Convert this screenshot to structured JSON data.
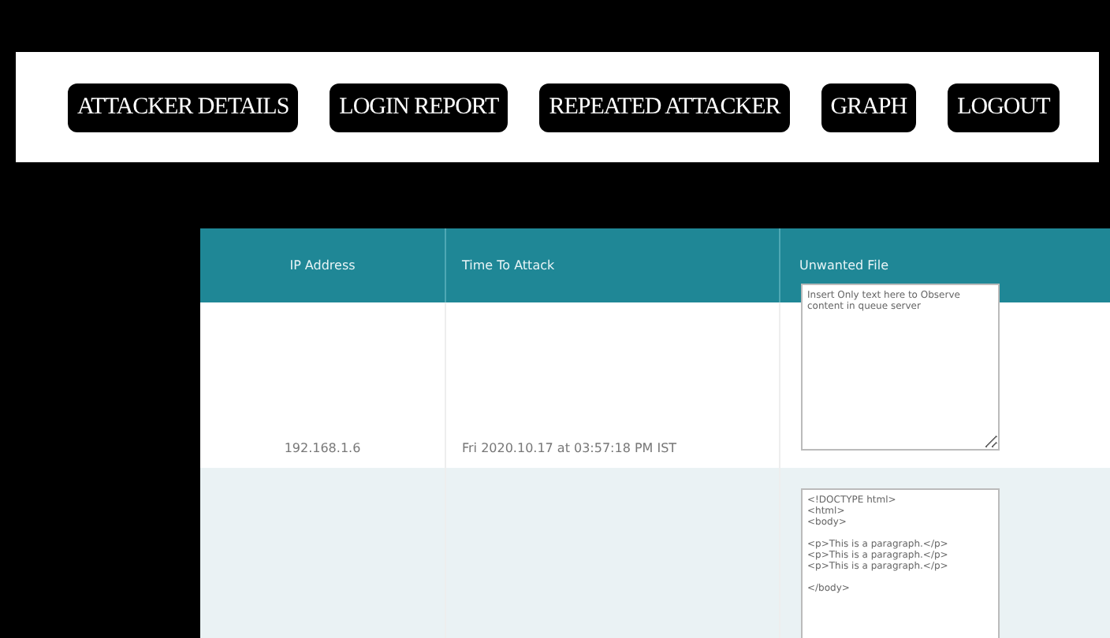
{
  "nav": {
    "buttons": [
      "ATTACKER DETAILS",
      "LOGIN REPORT",
      "REPEATED ATTACKER",
      "GRAPH",
      "LOGOUT"
    ]
  },
  "table": {
    "columns": [
      "IP Address",
      "Time To Attack",
      "Unwanted File"
    ],
    "rows": [
      {
        "ip": "192.168.1.6",
        "time": "Fri 2020.10.17 at 03:57:18 PM IST",
        "file": "Insert Only text here to Observe content in queue server"
      },
      {
        "ip": "",
        "time": "",
        "file": "<!DOCTYPE html>\n<html>\n<body>\n\n<p>This is a paragraph.</p>\n<p>This is a paragraph.</p>\n<p>This is a paragraph.</p>\n\n</body>"
      }
    ]
  }
}
